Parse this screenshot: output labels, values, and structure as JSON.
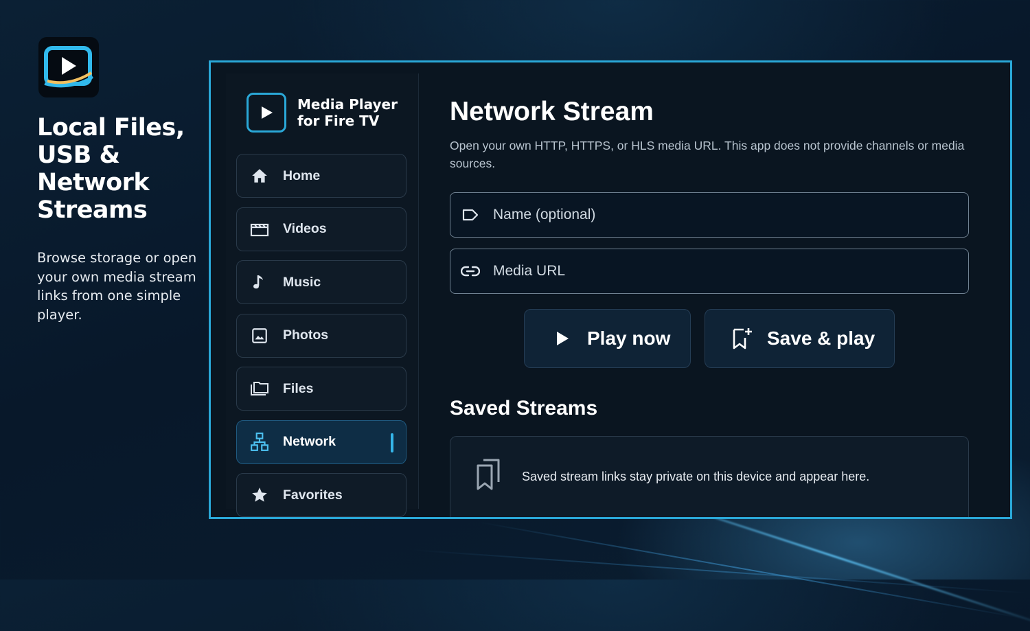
{
  "promo": {
    "title": "Local Files, USB & Network Streams",
    "description": "Browse storage or open your own media stream links from one simple player."
  },
  "app": {
    "name": "Media Player for Fire TV",
    "accent_color": "#2aa8d8"
  },
  "sidebar": {
    "items": [
      {
        "label": "Home",
        "icon": "home-icon",
        "active": false
      },
      {
        "label": "Videos",
        "icon": "clapperboard-icon",
        "active": false
      },
      {
        "label": "Music",
        "icon": "music-note-icon",
        "active": false
      },
      {
        "label": "Photos",
        "icon": "image-icon",
        "active": false
      },
      {
        "label": "Files",
        "icon": "folders-icon",
        "active": false
      },
      {
        "label": "Network",
        "icon": "network-icon",
        "active": true
      },
      {
        "label": "Favorites",
        "icon": "star-icon",
        "active": false
      }
    ]
  },
  "main": {
    "title": "Network Stream",
    "description": "Open your own HTTP, HTTPS, or HLS media URL. This app does not provide channels or media sources.",
    "name_field": {
      "placeholder": "Name (optional)",
      "value": "",
      "icon": "label-icon"
    },
    "url_field": {
      "placeholder": "Media URL",
      "value": "",
      "icon": "link-icon"
    },
    "play_button": {
      "label": "Play now",
      "icon": "play-icon"
    },
    "save_button": {
      "label": "Save & play",
      "icon": "bookmark-add-icon"
    },
    "saved_title": "Saved Streams",
    "saved_empty_message": "Saved stream links stay private on this device and appear here.",
    "saved_icon": "bookmarks-icon"
  }
}
